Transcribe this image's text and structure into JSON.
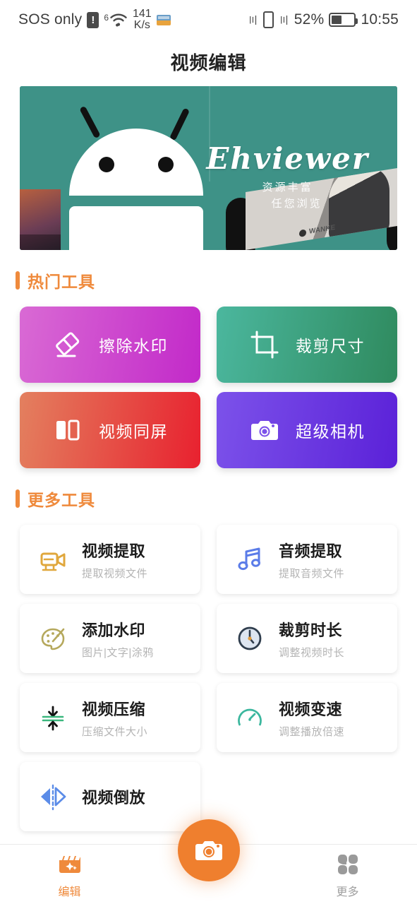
{
  "status_bar": {
    "carrier": "SOS only",
    "sim_alert_icon": "sim-alert-icon",
    "network_generation": "6",
    "wifi_icon": "wifi-icon",
    "net_speed_value": "141",
    "net_speed_unit": "K/s",
    "app_badge_icon": "app-badge-icon",
    "vibrate_icon": "vibrate-icon",
    "battery_percent": "52%",
    "battery_icon": "battery-icon",
    "battery_level": 52,
    "time": "10:55"
  },
  "header": {
    "title": "视频编辑"
  },
  "banner": {
    "brand": "Ehviewer",
    "tagline_line1": "资源丰富",
    "tagline_line2": "任您浏览",
    "watermark": "WANKE",
    "bg_color": "#3e9287",
    "mascot_icon": "android-robot-icon"
  },
  "sections": {
    "hot_tools": {
      "title": "热门工具",
      "accent": "#ef8a3c"
    },
    "more_tools": {
      "title": "更多工具",
      "accent": "#ef8a3c"
    }
  },
  "hot_tools": [
    {
      "label": "擦除水印",
      "icon": "eraser-icon",
      "grad_from": "#d96ad4",
      "grad_to": "#c229c9"
    },
    {
      "label": "裁剪尺寸",
      "icon": "crop-icon",
      "grad_from": "#4bb79e",
      "grad_to": "#2f8a5e"
    },
    {
      "label": "视频同屏",
      "icon": "split-screen-icon",
      "grad_from": "#e3805f",
      "grad_to": "#e8212f"
    },
    {
      "label": "超级相机",
      "icon": "camera-icon",
      "grad_from": "#7c52ea",
      "grad_to": "#5b21d8"
    }
  ],
  "more_tools": [
    {
      "title": "视频提取",
      "subtitle": "提取视频文件",
      "icon": "camcorder-icon",
      "color": "#e0a73c"
    },
    {
      "title": "音频提取",
      "subtitle": "提取音频文件",
      "icon": "music-note-icon",
      "color": "#5b7ce8"
    },
    {
      "title": "添加水印",
      "subtitle": "图片|文字|涂鸦",
      "icon": "palette-icon",
      "color": "#b5a85c"
    },
    {
      "title": "裁剪时长",
      "subtitle": "调整视频时长",
      "icon": "clock-icon",
      "color": "#3a4a5c"
    },
    {
      "title": "视频压缩",
      "subtitle": "压缩文件大小",
      "icon": "compress-icon",
      "color": "#3bb77e"
    },
    {
      "title": "视频变速",
      "subtitle": "调整播放倍速",
      "icon": "speedometer-icon",
      "color": "#3bb79e"
    },
    {
      "title": "视频倒放",
      "subtitle": "",
      "icon": "reverse-icon",
      "color": "#5b8ce8"
    }
  ],
  "bottom_nav": {
    "items": [
      {
        "label": "编辑",
        "icon": "clapperboard-sparkle-icon",
        "active": true,
        "color": "#ef8a3c"
      },
      {
        "label": "更多",
        "icon": "grid-icon",
        "active": false,
        "color": "#a0a0a0"
      }
    ],
    "fab": {
      "icon": "camera-icon",
      "color": "#ef7f2e"
    }
  }
}
